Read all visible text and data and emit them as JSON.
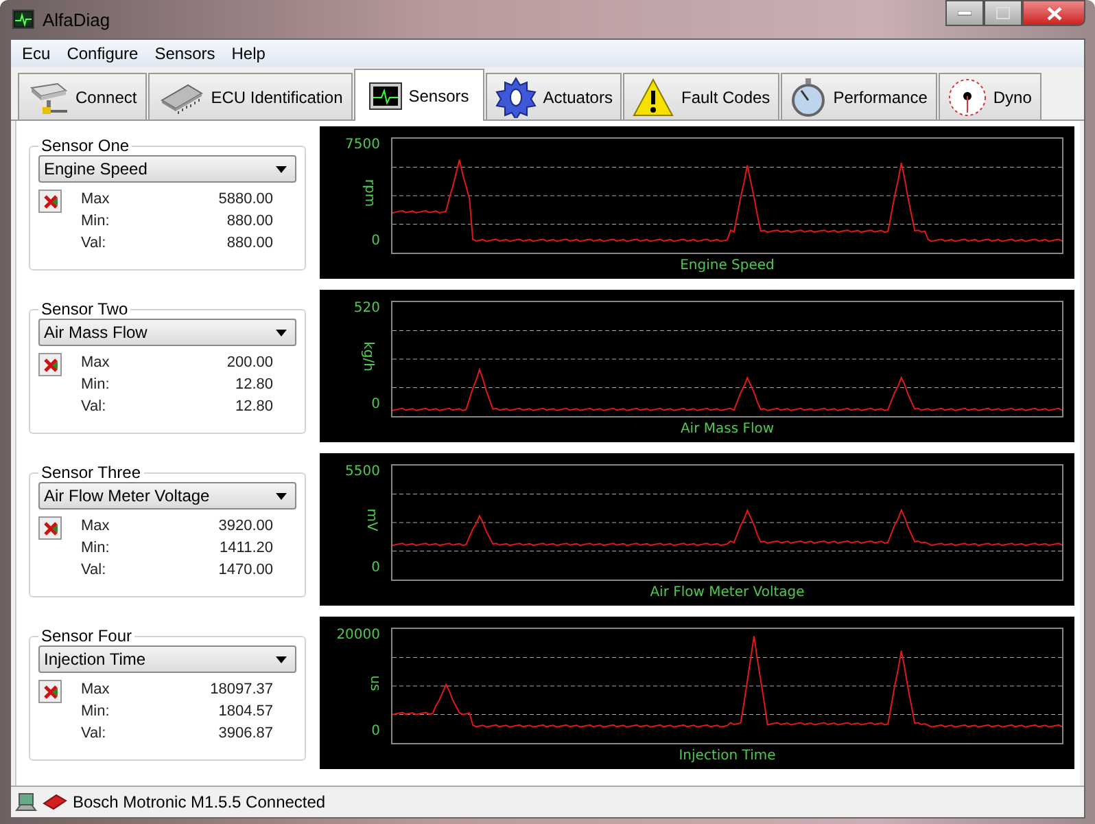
{
  "window": {
    "title": "AlfaDiag"
  },
  "menu": [
    "Ecu",
    "Configure",
    "Sensors",
    "Help"
  ],
  "tabs": [
    {
      "label": "Connect",
      "selected": false
    },
    {
      "label": "ECU Identification",
      "selected": false
    },
    {
      "label": "Sensors",
      "selected": true
    },
    {
      "label": "Actuators",
      "selected": false
    },
    {
      "label": "Fault Codes",
      "selected": false
    },
    {
      "label": "Performance",
      "selected": false
    },
    {
      "label": "Dyno",
      "selected": false
    }
  ],
  "sensors": [
    {
      "group": "Sensor One",
      "selection": "Engine Speed",
      "max_label": "Max",
      "max": "5880.00",
      "min_label": "Min:",
      "min": "880.00",
      "val_label": "Val:",
      "val": "880.00"
    },
    {
      "group": "Sensor Two",
      "selection": "Air Mass Flow",
      "max_label": "Max",
      "max": "200.00",
      "min_label": "Min:",
      "min": "12.80",
      "val_label": "Val:",
      "val": "12.80"
    },
    {
      "group": "Sensor Three",
      "selection": "Air Flow Meter Voltage",
      "max_label": "Max",
      "max": "3920.00",
      "min_label": "Min:",
      "min": "1411.20",
      "val_label": "Val:",
      "val": "1470.00"
    },
    {
      "group": "Sensor Four",
      "selection": "Injection Time",
      "max_label": "Max",
      "max": "18097.37",
      "min_label": "Min:",
      "min": "1804.57",
      "val_label": "Val:",
      "val": "3906.87"
    }
  ],
  "charts": [
    {
      "title": "Engine Speed",
      "unit": "rpm",
      "y_max": "7500",
      "y_min": "0"
    },
    {
      "title": "Air Mass Flow",
      "unit": "kg/h",
      "y_max": "520",
      "y_min": "0"
    },
    {
      "title": "Air Flow Meter Voltage",
      "unit": "mV",
      "y_max": "5500",
      "y_min": "0"
    },
    {
      "title": "Injection Time",
      "unit": "us",
      "y_max": "20000",
      "y_min": "0"
    }
  ],
  "status_bar": {
    "text": "Bosch Motronic M1.5.5 Connected"
  }
}
